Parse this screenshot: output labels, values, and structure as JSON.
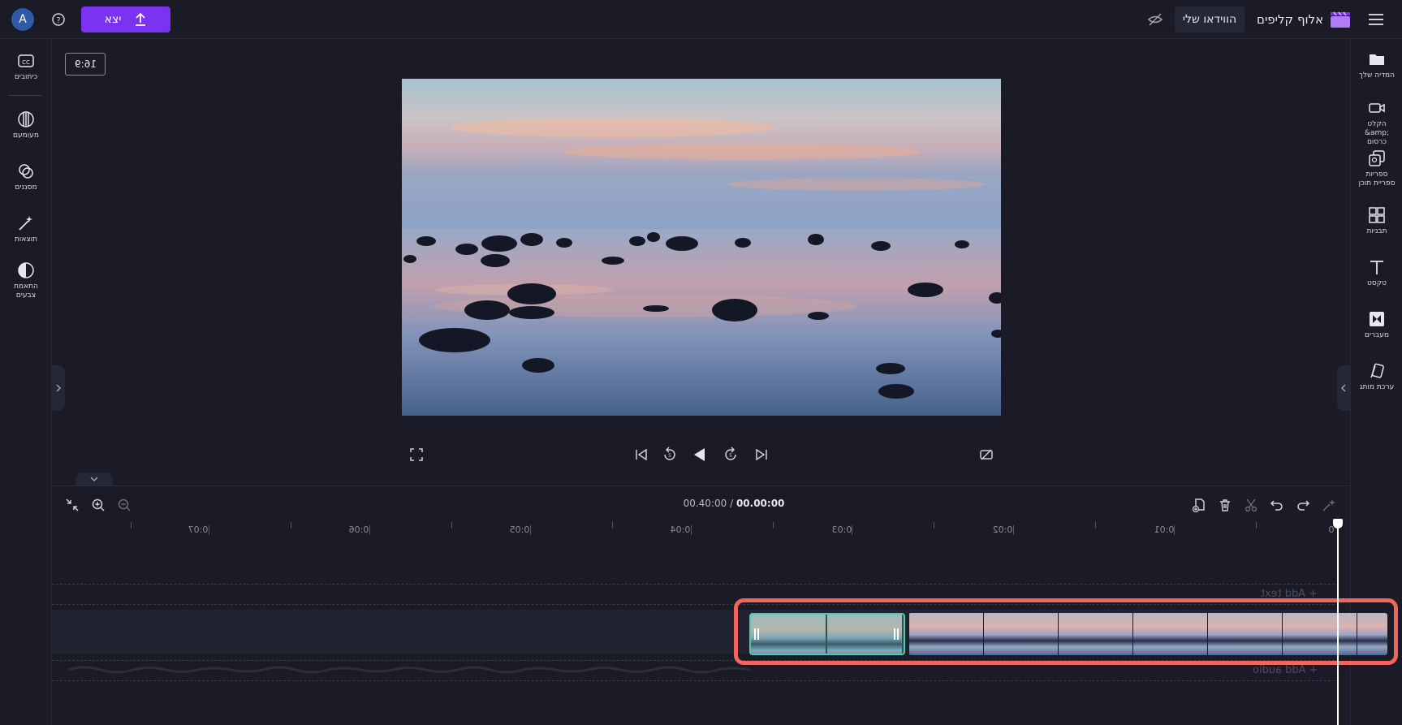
{
  "topbar": {
    "avatar_letter": "A",
    "export_label": "יצא",
    "my_video_label": "הווידאו שלי",
    "brand_name": "אלוף קליפים"
  },
  "left_tools": [
    {
      "id": "captions",
      "label": "כיתובים"
    },
    {
      "id": "fade",
      "label": "מעומעם"
    },
    {
      "id": "filters",
      "label": "מסננים"
    },
    {
      "id": "effects",
      "label": "תוצאות"
    },
    {
      "id": "color",
      "label": "התאמת צבעים"
    }
  ],
  "right_tools": [
    {
      "id": "media",
      "label": "המדיה שלך"
    },
    {
      "id": "record",
      "label": "הקלט &amp; כרסום"
    },
    {
      "id": "library",
      "label": "ספריות ספריית תוכן"
    },
    {
      "id": "templates",
      "label": "תבניות"
    },
    {
      "id": "text",
      "label": "טקסט"
    },
    {
      "id": "transitions",
      "label": "מעברים"
    },
    {
      "id": "brand",
      "label": "ערכת מותג"
    }
  ],
  "preview": {
    "aspect_ratio": "16:9"
  },
  "timeline": {
    "current_time": "00.00:00",
    "total_time": "00.40:00",
    "separator": "/",
    "ruler_labels": [
      "0",
      "0:01",
      "0:02",
      "0:03",
      "0:04",
      "0:05",
      "0:06",
      "0:07"
    ],
    "add_text_label": "+ Add text",
    "add_audio_label": "+ Add audio"
  },
  "colors": {
    "accent": "#7b33f2",
    "selection": "#57c6a9",
    "highlight": "#f0665c",
    "background": "#1a1b26"
  }
}
